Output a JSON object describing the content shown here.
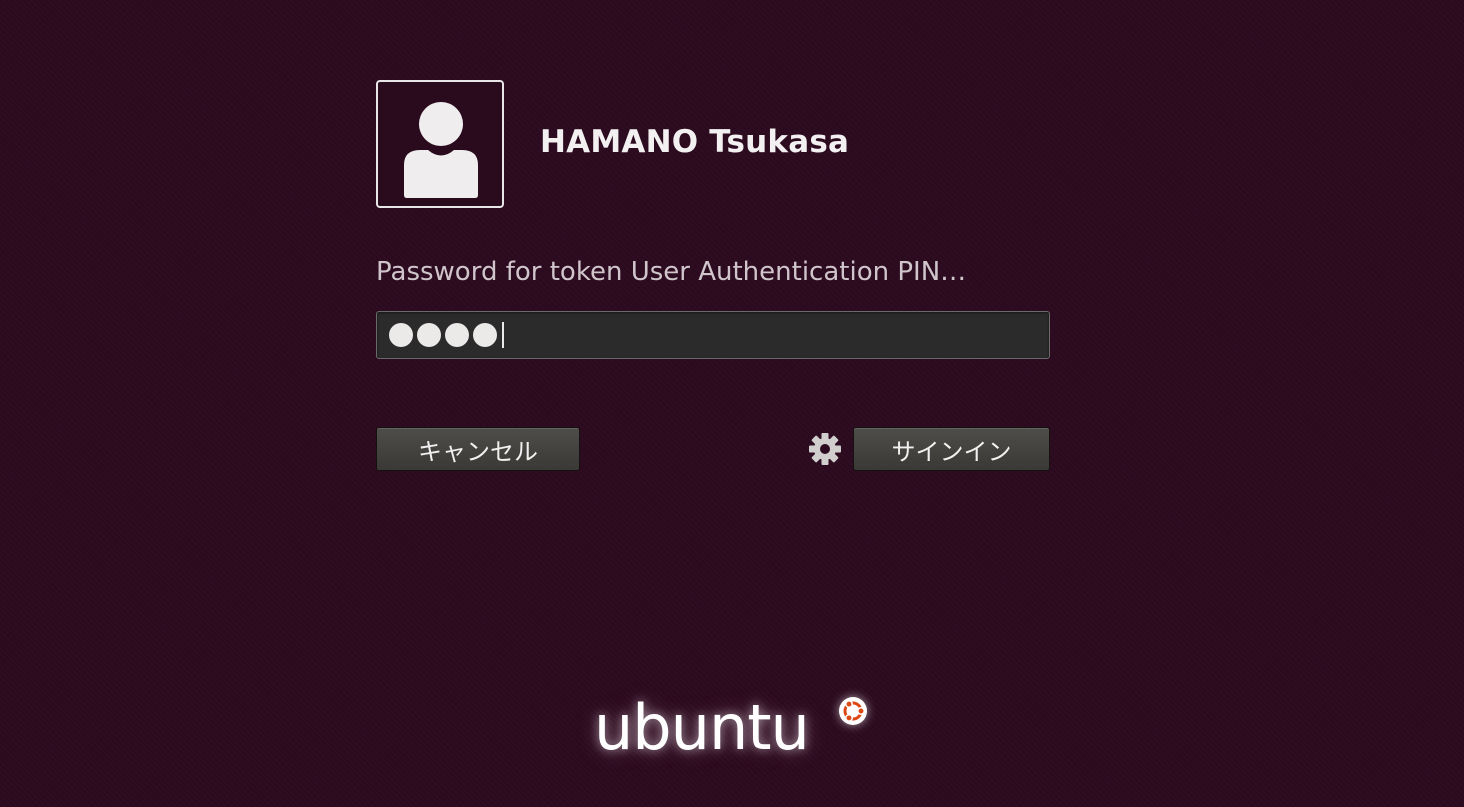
{
  "user": {
    "name": "HAMANO Tsukasa"
  },
  "prompt": {
    "label": "Password for token User Authentication PIN…"
  },
  "password": {
    "masked_length": 4
  },
  "buttons": {
    "cancel_label": "キャンセル",
    "signin_label": "サインイン"
  },
  "icons": {
    "avatar": "user-avatar-icon",
    "session": "gear-icon",
    "logo": "ubuntu-logo"
  },
  "logo": {
    "wordmark": "ubuntu"
  },
  "colors": {
    "background": "#2c0a1f",
    "field": "#2b2b2b",
    "button": "#45433f",
    "text": "#f2f0f0",
    "label": "#cfc5ca",
    "accent": "#dd4814"
  }
}
